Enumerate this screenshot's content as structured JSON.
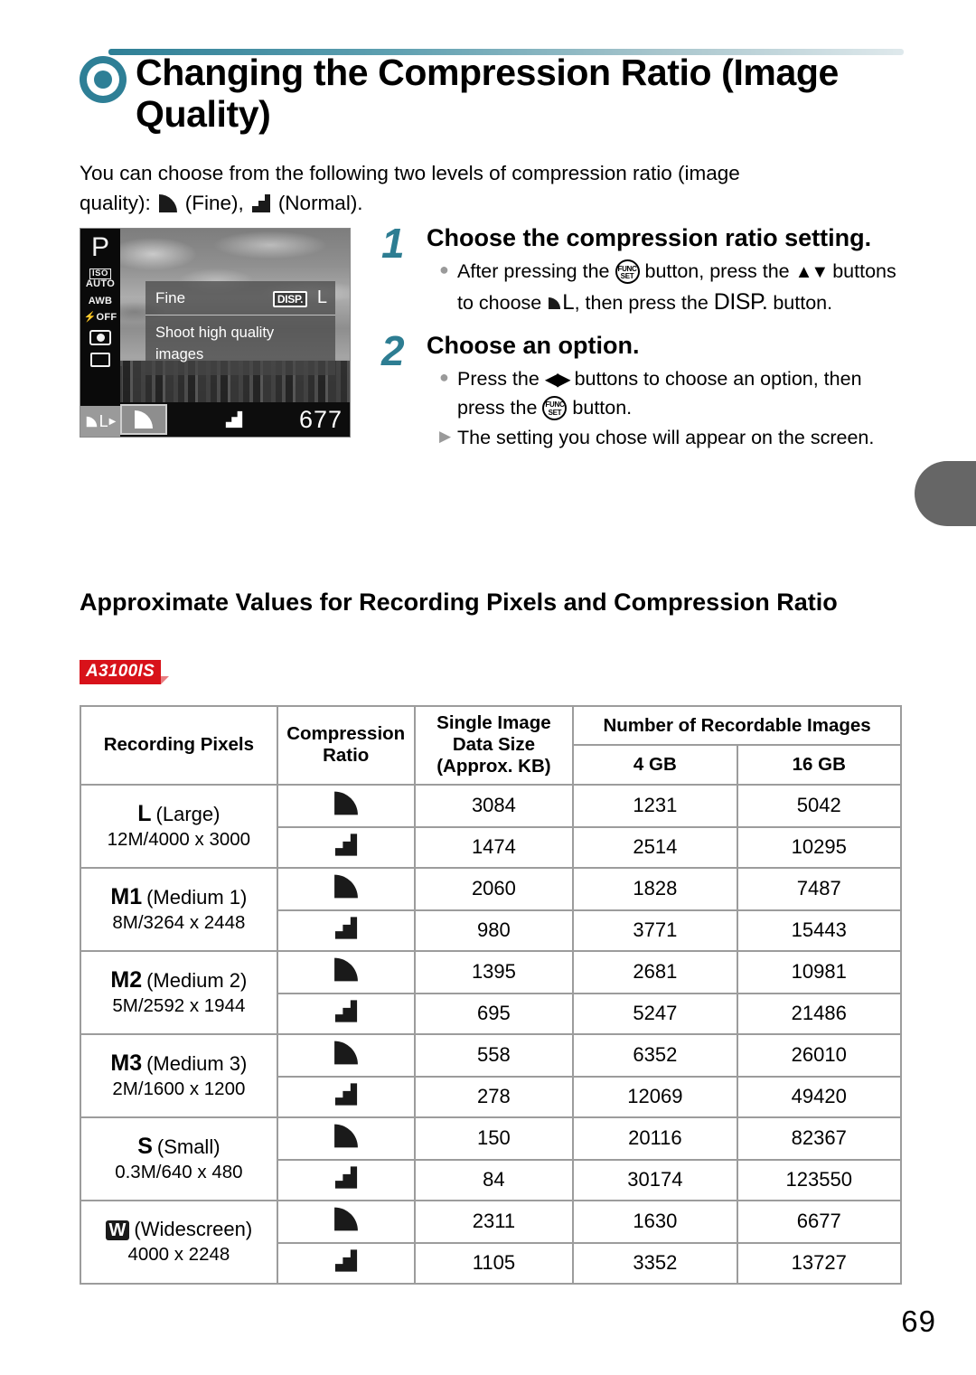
{
  "header": {
    "title": "Changing the Compression Ratio (Image Quality)",
    "accent_color": "#2e7f96",
    "bullet_icon": "ring-icon"
  },
  "intro": {
    "line1": "You can choose from the following two levels of compression ratio (image",
    "line2_prefix": "quality):",
    "fine_label": "(Fine),",
    "normal_label": "(Normal)."
  },
  "camera_screen": {
    "mode": "P",
    "left_icons": {
      "iso_top": "ISO",
      "iso_bottom": "AUTO",
      "white_balance": "AWB",
      "flash": "OFF",
      "metering": "metering-icon",
      "drive": "drive-icon"
    },
    "selected_setting": "L",
    "menu": {
      "option_name": "Fine",
      "disp_badge": "DISP.",
      "size_glyph": "L",
      "description": "Shoot high quality images"
    },
    "bottom_bar": {
      "option_fine": "fine-icon",
      "option_normal": "normal-icon",
      "shots_remaining": "677"
    }
  },
  "steps": [
    {
      "number": "1",
      "title": "Choose the compression ratio setting.",
      "bullets": [
        {
          "marker": "dot",
          "seg1": "After pressing the",
          "seg2": "button, press the",
          "seg3": "buttons to choose",
          "seg4": ", then press the",
          "seg5": "button.",
          "func_top": "FUNC",
          "func_bottom": "SET",
          "updown": "▲▼",
          "choose_glyph": "L",
          "disp": "DISP."
        }
      ]
    },
    {
      "number": "2",
      "title": "Choose an option.",
      "bullets": [
        {
          "marker": "dot",
          "seg1": "Press the",
          "seg2": "buttons to choose an option, then press the",
          "seg3": "button.",
          "leftright": "◀▶",
          "func_top": "FUNC",
          "func_bottom": "SET"
        },
        {
          "marker": "triangle",
          "text": "The setting you chose will appear on the screen."
        }
      ]
    }
  ],
  "section": {
    "heading": "Approximate Values for Recording Pixels and Compression Ratio",
    "model_badge": "A3100IS",
    "badge_color": "#d8121a"
  },
  "table": {
    "headers": {
      "recording_pixels": "Recording Pixels",
      "compression_ratio": "Compression Ratio",
      "single_image_data_size": "Single Image Data Size (Approx. KB)",
      "number_of_recordable_images": "Number of Recordable Images",
      "gb4": "4 GB",
      "gb16": "16 GB"
    },
    "rows": [
      {
        "glyph": "L",
        "glyph_boxed": false,
        "label": "(Large)",
        "dimensions": "12M/4000 x 3000",
        "fine": {
          "ratio_icon": "fine-icon",
          "data_size": "3084",
          "gb4": "1231",
          "gb16": "5042"
        },
        "normal": {
          "ratio_icon": "normal-icon",
          "data_size": "1474",
          "gb4": "2514",
          "gb16": "10295"
        }
      },
      {
        "glyph": "M1",
        "glyph_boxed": false,
        "label": "(Medium 1)",
        "dimensions": "8M/3264 x 2448",
        "fine": {
          "ratio_icon": "fine-icon",
          "data_size": "2060",
          "gb4": "1828",
          "gb16": "7487"
        },
        "normal": {
          "ratio_icon": "normal-icon",
          "data_size": "980",
          "gb4": "3771",
          "gb16": "15443"
        }
      },
      {
        "glyph": "M2",
        "glyph_boxed": false,
        "label": "(Medium 2)",
        "dimensions": "5M/2592 x 1944",
        "fine": {
          "ratio_icon": "fine-icon",
          "data_size": "1395",
          "gb4": "2681",
          "gb16": "10981"
        },
        "normal": {
          "ratio_icon": "normal-icon",
          "data_size": "695",
          "gb4": "5247",
          "gb16": "21486"
        }
      },
      {
        "glyph": "M3",
        "glyph_boxed": false,
        "label": "(Medium 3)",
        "dimensions": "2M/1600 x 1200",
        "fine": {
          "ratio_icon": "fine-icon",
          "data_size": "558",
          "gb4": "6352",
          "gb16": "26010"
        },
        "normal": {
          "ratio_icon": "normal-icon",
          "data_size": "278",
          "gb4": "12069",
          "gb16": "49420"
        }
      },
      {
        "glyph": "S",
        "glyph_boxed": false,
        "label": "(Small)",
        "dimensions": "0.3M/640 x 480",
        "fine": {
          "ratio_icon": "fine-icon",
          "data_size": "150",
          "gb4": "20116",
          "gb16": "82367"
        },
        "normal": {
          "ratio_icon": "normal-icon",
          "data_size": "84",
          "gb4": "30174",
          "gb16": "123550"
        }
      },
      {
        "glyph": "W",
        "glyph_boxed": true,
        "label": "(Widescreen)",
        "dimensions": "4000 x 2248",
        "fine": {
          "ratio_icon": "fine-icon",
          "data_size": "2311",
          "gb4": "1630",
          "gb16": "6677"
        },
        "normal": {
          "ratio_icon": "normal-icon",
          "data_size": "1105",
          "gb4": "3352",
          "gb16": "13727"
        }
      }
    ]
  },
  "footer": {
    "page_number": "69"
  }
}
